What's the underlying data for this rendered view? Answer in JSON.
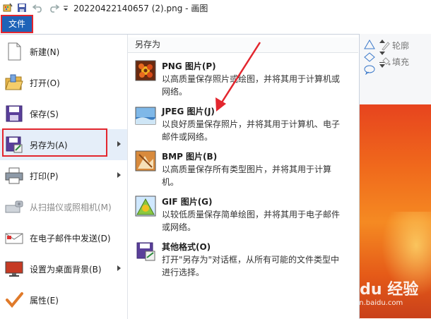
{
  "titlebar": {
    "title": "20220422140657 (2).png - 画图"
  },
  "file_tab": {
    "label": "文件"
  },
  "ribbon": {
    "outline_label": "轮廓",
    "fill_label": "填充"
  },
  "menu": {
    "items": [
      {
        "label": "新建(N)",
        "icon": "new-file-icon"
      },
      {
        "label": "打开(O)",
        "icon": "open-folder-icon"
      },
      {
        "label": "保存(S)",
        "icon": "save-disk-icon"
      },
      {
        "label": "另存为(A)",
        "icon": "save-as-icon",
        "submenu": true
      },
      {
        "label": "打印(P)",
        "icon": "printer-icon",
        "submenu": true
      },
      {
        "label": "从扫描仪或照相机(M)",
        "icon": "scanner-icon",
        "disabled": true
      },
      {
        "label": "在电子邮件中发送(D)",
        "icon": "email-icon"
      },
      {
        "label": "设置为桌面背景(B)",
        "icon": "desktop-background-icon",
        "submenu": true
      },
      {
        "label": "属性(E)",
        "icon": "properties-check-icon"
      }
    ]
  },
  "saveas_panel": {
    "title": "另存为",
    "formats": [
      {
        "name": "PNG 图片(P)",
        "desc": "以高质量保存照片或绘图，并将其用于计算机或网络。",
        "icon": "png-image-icon"
      },
      {
        "name": "JPEG 图片(J)",
        "desc": "以良好质量保存照片，并将其用于计算机、电子邮件或网络。",
        "icon": "jpeg-image-icon"
      },
      {
        "name": "BMP 图片(B)",
        "desc": "以高质量保存所有类型图片，并将其用于计算机。",
        "icon": "bmp-image-icon"
      },
      {
        "name": "GIF 图片(G)",
        "desc": "以较低质量保存简单绘图，并将其用于电子邮件或网络。",
        "icon": "gif-image-icon"
      },
      {
        "name": "其他格式(O)",
        "desc": "打开\"另存为\"对话框，从所有可能的文件类型中进行选择。",
        "icon": "other-formats-icon"
      }
    ]
  },
  "watermark": {
    "text": "Baidu 经验",
    "sub": "jingyan.baidu.com"
  },
  "colors": {
    "file_tab": "#1e63b8",
    "highlight_box": "#e3262e",
    "annotation_arrow": "#e3262e"
  }
}
